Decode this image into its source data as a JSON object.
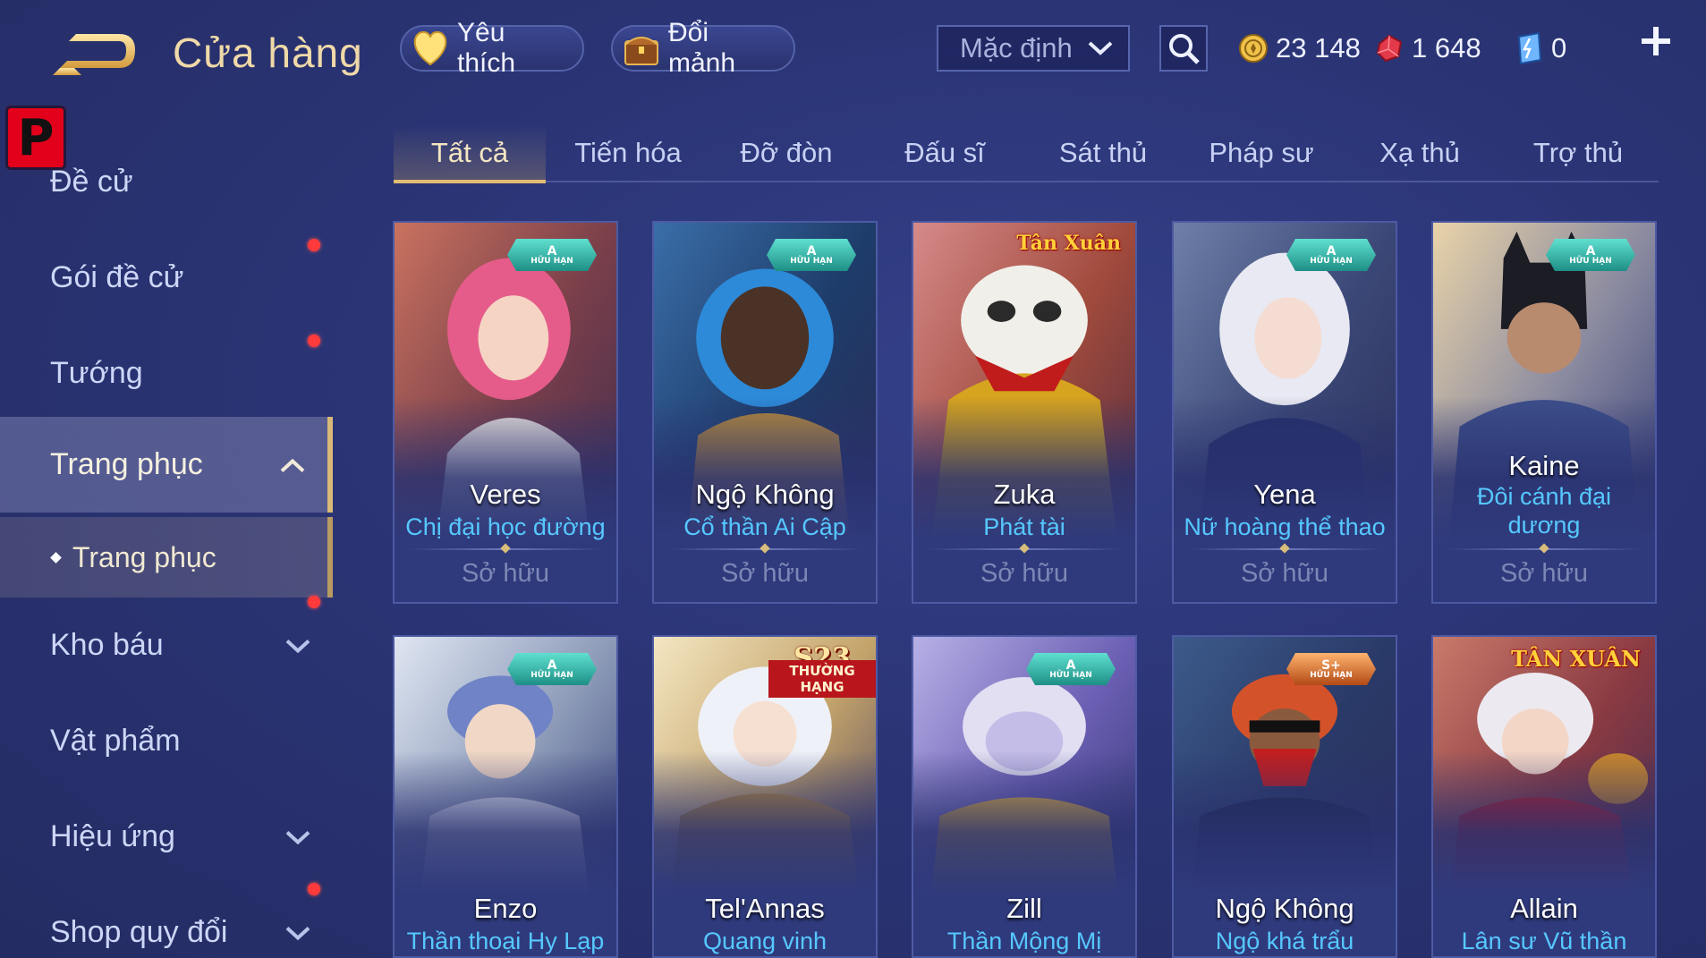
{
  "header": {
    "title": "Cửa hàng",
    "favorite_label": "Yêu thích",
    "exchange_label": "Đổi mảnh",
    "sort_value": "Mặc định",
    "gold": "23 148",
    "ruby": "1 648",
    "voucher": "0"
  },
  "logo_letter": "P",
  "sidebar": {
    "items": [
      {
        "label": "Đề cử"
      },
      {
        "label": "Gói đề cử"
      },
      {
        "label": "Tướng"
      },
      {
        "label": "Trang phục"
      },
      {
        "label": "Trang phục"
      },
      {
        "label": "Kho báu"
      },
      {
        "label": "Vật phẩm"
      },
      {
        "label": "Hiệu ứng"
      },
      {
        "label": "Shop quy đổi"
      }
    ]
  },
  "tabs": [
    {
      "label": "Tất cả"
    },
    {
      "label": "Tiến hóa"
    },
    {
      "label": "Đỡ đòn"
    },
    {
      "label": "Đấu sĩ"
    },
    {
      "label": "Sát thủ"
    },
    {
      "label": "Pháp sư"
    },
    {
      "label": "Xạ thủ"
    },
    {
      "label": "Trợ thủ"
    }
  ],
  "cards": [
    {
      "hero": "Veres",
      "skin": "Chị đại học đường",
      "status": "Sở hữu",
      "badge_grade": "A",
      "badge_text": "HỮU HẠN"
    },
    {
      "hero": "Ngộ Không",
      "skin": "Cổ thần Ai Cập",
      "status": "Sở hữu",
      "badge_grade": "A",
      "badge_text": "HỮU HẠN"
    },
    {
      "hero": "Zuka",
      "skin": "Phát tài",
      "status": "Sở hữu",
      "badge_label": "Tân Xuân"
    },
    {
      "hero": "Yena",
      "skin": "Nữ hoàng thể thao",
      "status": "Sở hữu",
      "badge_grade": "A",
      "badge_text": "HỮU HẠN"
    },
    {
      "hero": "Kaine",
      "skin": "Đôi cánh đại dương",
      "status": "Sở hữu",
      "badge_grade": "A",
      "badge_text": "HỮU HẠN"
    },
    {
      "hero": "Enzo",
      "skin": "Thần thoại Hy Lạp",
      "badge_grade": "A",
      "badge_text": "HỮU HẠN"
    },
    {
      "hero": "Tel'Annas",
      "skin": "Quang vinh",
      "badge_season": "S23",
      "badge_rank": "THƯỜNG HẠNG"
    },
    {
      "hero": "Zill",
      "skin": "Thần Mộng Mị",
      "badge_grade": "A",
      "badge_text": "HỮU HẠN"
    },
    {
      "hero": "Ngộ Không",
      "skin": "Ngộ khá trẩu",
      "badge_grade": "S+",
      "badge_text": "HỮU HẠN"
    },
    {
      "hero": "Allain",
      "skin": "Lân sư Vũ thần",
      "badge_label": "TÂN XUÂN"
    }
  ],
  "colors": {
    "background": "#2b3576",
    "title_gold": "#f0d9a8",
    "skin_name_blue": "#56c8ff",
    "owned_gray": "#7d87b6",
    "tab_active_underline": "#e2bc72",
    "notification_red": "#ff3a3a"
  },
  "icons": [
    "back-arrow-icon",
    "heart-icon",
    "treasure-chest-icon",
    "chevron-down-icon",
    "search-icon",
    "gold-coin-icon",
    "ruby-gem-icon",
    "voucher-icon",
    "plus-icon",
    "chevron-up-icon"
  ]
}
